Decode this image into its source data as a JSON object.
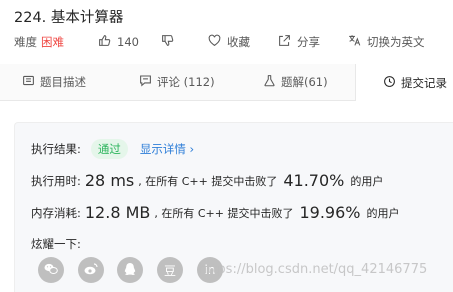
{
  "problem": {
    "title": "224. 基本计算器"
  },
  "meta": {
    "difficulty_label": "难度",
    "difficulty_value": "困难",
    "likes": "140",
    "favorite_label": "收藏",
    "share_label": "分享",
    "switch_lang_label": "切换为英文"
  },
  "tabs": [
    {
      "label": "题目描述"
    },
    {
      "label": "评论 (112)"
    },
    {
      "label": "题解(61)"
    },
    {
      "label": "提交记录"
    }
  ],
  "result": {
    "label": "执行结果:",
    "status": "通过",
    "details_link": "显示详情 ›",
    "time_label": "执行用时:",
    "time_value": "28 ms",
    "time_desc": ", 在所有 C++ 提交中击败了",
    "time_percent": "41.70%",
    "user_suffix": "的用户",
    "memory_label": "内存消耗:",
    "memory_value": "12.8 MB",
    "memory_desc": ", 在所有 C++ 提交中击败了",
    "memory_percent": "19.96%",
    "show_off_label": "炫耀一下:",
    "douban_glyph": "豆",
    "in_glyph": "in"
  },
  "watermark": "https://blog.csdn.net/qq_42146775",
  "colors": {
    "hard": "#ef4743",
    "accepted_bg": "#e5f6ea",
    "accepted_text": "#2db55d",
    "link": "#2e7ed8"
  }
}
